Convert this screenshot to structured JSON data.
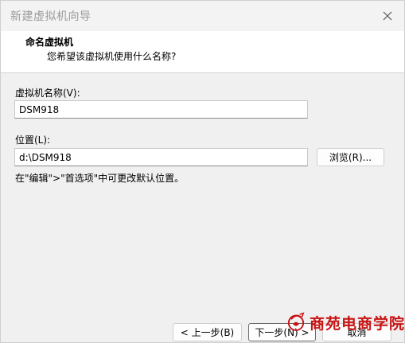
{
  "window": {
    "title": "新建虚拟机向导",
    "close_label": "✕"
  },
  "header": {
    "title": "命名虚拟机",
    "subtitle": "您希望该虚拟机使用什么名称?"
  },
  "form": {
    "name_label": "虚拟机名称(V):",
    "name_value": "DSM918",
    "location_label": "位置(L):",
    "location_value": "d:\\DSM918",
    "browse_label": "浏览(R)...",
    "hint": "在\"编辑\">\"首选项\"中可更改默认位置。"
  },
  "footer": {
    "back_label": "< 上一步(B)",
    "next_label": "下一步(N) >",
    "cancel_label": "取消"
  },
  "watermark": {
    "text": "商苑电商学院",
    "color": "#c81414"
  }
}
